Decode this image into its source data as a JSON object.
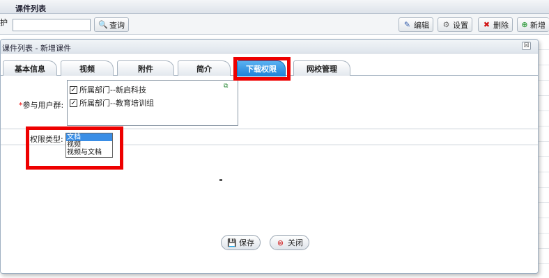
{
  "background": {
    "list_title": "课件列表",
    "left_cut_text": "护",
    "search_button": "查询",
    "toolbar": {
      "edit": "编辑",
      "settings": "设置",
      "delete": "删除",
      "add": "新增"
    }
  },
  "dialog": {
    "title": "课件列表 - 新增课件",
    "close_glyph": "☒",
    "tabs": [
      {
        "label": "基本信息"
      },
      {
        "label": "视频"
      },
      {
        "label": "附件"
      },
      {
        "label": "简介"
      },
      {
        "label": "下载权限",
        "active": true
      },
      {
        "label": "网校管理"
      }
    ],
    "user_group": {
      "required_mark": "*",
      "label": "参与用户群:",
      "items": [
        {
          "label": "所属部门--新启科技",
          "checked": true
        },
        {
          "label": "所属部门--教育培训组",
          "checked": true
        }
      ]
    },
    "permission_type": {
      "label": "权限类型:",
      "options": [
        "文档",
        "视频",
        "视频与文档"
      ],
      "selected": "文档"
    },
    "buttons": {
      "save": "保存",
      "close": "关闭"
    }
  },
  "colors": {
    "active_tab": "#2a8ee0",
    "highlight_box": "#ee0000"
  }
}
